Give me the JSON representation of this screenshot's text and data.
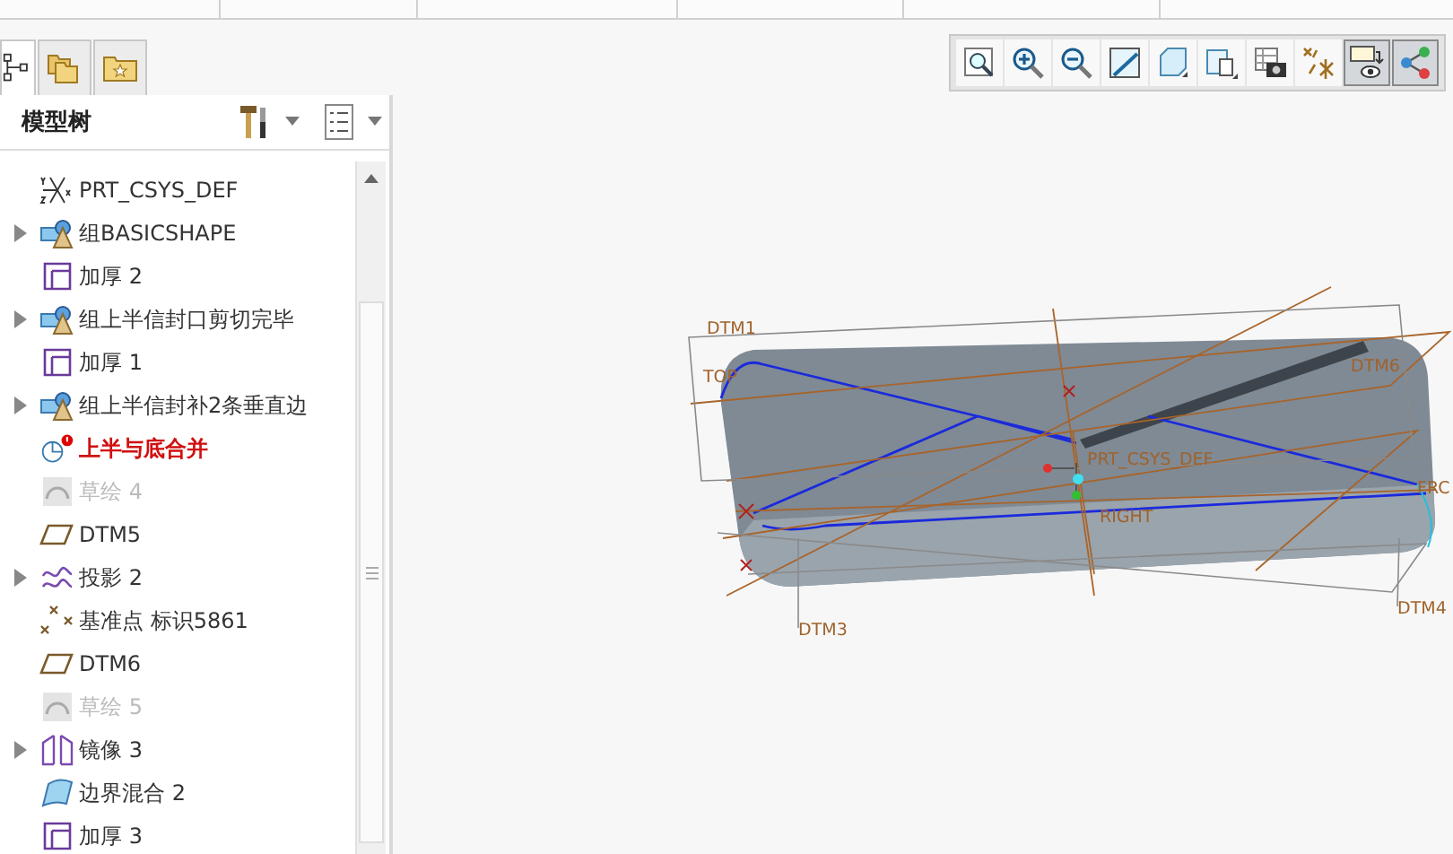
{
  "nav_tabs": [
    {
      "kind": "tree",
      "selected": true
    },
    {
      "kind": "folders",
      "selected": false
    },
    {
      "kind": "favorites",
      "selected": false
    }
  ],
  "model_tree": {
    "title": "模型树",
    "items": [
      {
        "label": "PRT_CSYS_DEF",
        "kind": "csys",
        "expandable": false,
        "error": false,
        "suppressed": false
      },
      {
        "label": "组BASICSHAPE",
        "kind": "group",
        "expandable": true,
        "error": false,
        "suppressed": false
      },
      {
        "label": "加厚 2",
        "kind": "thicken",
        "expandable": false,
        "error": false,
        "suppressed": false
      },
      {
        "label": "组上半信封口剪切完毕",
        "kind": "group",
        "expandable": true,
        "error": false,
        "suppressed": false
      },
      {
        "label": "加厚 1",
        "kind": "thicken",
        "expandable": false,
        "error": false,
        "suppressed": false
      },
      {
        "label": "组上半信封补2条垂直边",
        "kind": "group",
        "expandable": true,
        "error": false,
        "suppressed": false
      },
      {
        "label": "上半与底合并",
        "kind": "merge",
        "expandable": false,
        "error": true,
        "suppressed": false
      },
      {
        "label": "草绘 4",
        "kind": "sketch",
        "expandable": false,
        "error": false,
        "suppressed": true
      },
      {
        "label": "DTM5",
        "kind": "plane",
        "expandable": false,
        "error": false,
        "suppressed": false
      },
      {
        "label": "投影 2",
        "kind": "projection",
        "expandable": true,
        "error": false,
        "suppressed": false
      },
      {
        "label": "基准点 标识5861",
        "kind": "point",
        "expandable": false,
        "error": false,
        "suppressed": false
      },
      {
        "label": "DTM6",
        "kind": "plane",
        "expandable": false,
        "error": false,
        "suppressed": false
      },
      {
        "label": "草绘 5",
        "kind": "sketch",
        "expandable": false,
        "error": false,
        "suppressed": true
      },
      {
        "label": "镜像 3",
        "kind": "mirror",
        "expandable": true,
        "error": false,
        "suppressed": false
      },
      {
        "label": "边界混合 2",
        "kind": "boundary",
        "expandable": false,
        "error": false,
        "suppressed": false
      },
      {
        "label": "加厚 3",
        "kind": "thicken",
        "expandable": false,
        "error": false,
        "suppressed": false
      }
    ]
  },
  "view_toolbar": [
    {
      "kind": "refit",
      "on": false
    },
    {
      "kind": "zoom-in",
      "on": false
    },
    {
      "kind": "zoom-out",
      "on": false
    },
    {
      "kind": "orient",
      "on": false
    },
    {
      "kind": "saved-views",
      "on": false
    },
    {
      "kind": "display-style",
      "on": false
    },
    {
      "kind": "snapshot",
      "on": false
    },
    {
      "kind": "datum-display",
      "on": false
    },
    {
      "kind": "annotation",
      "on": true
    },
    {
      "kind": "spin-center",
      "on": true
    }
  ],
  "model_labels": [
    "DTM1",
    "TOP",
    "DTM6",
    "PRT_CSYS_DEF",
    "RIGHT",
    "FRC",
    "DTM4",
    "DTM3"
  ]
}
